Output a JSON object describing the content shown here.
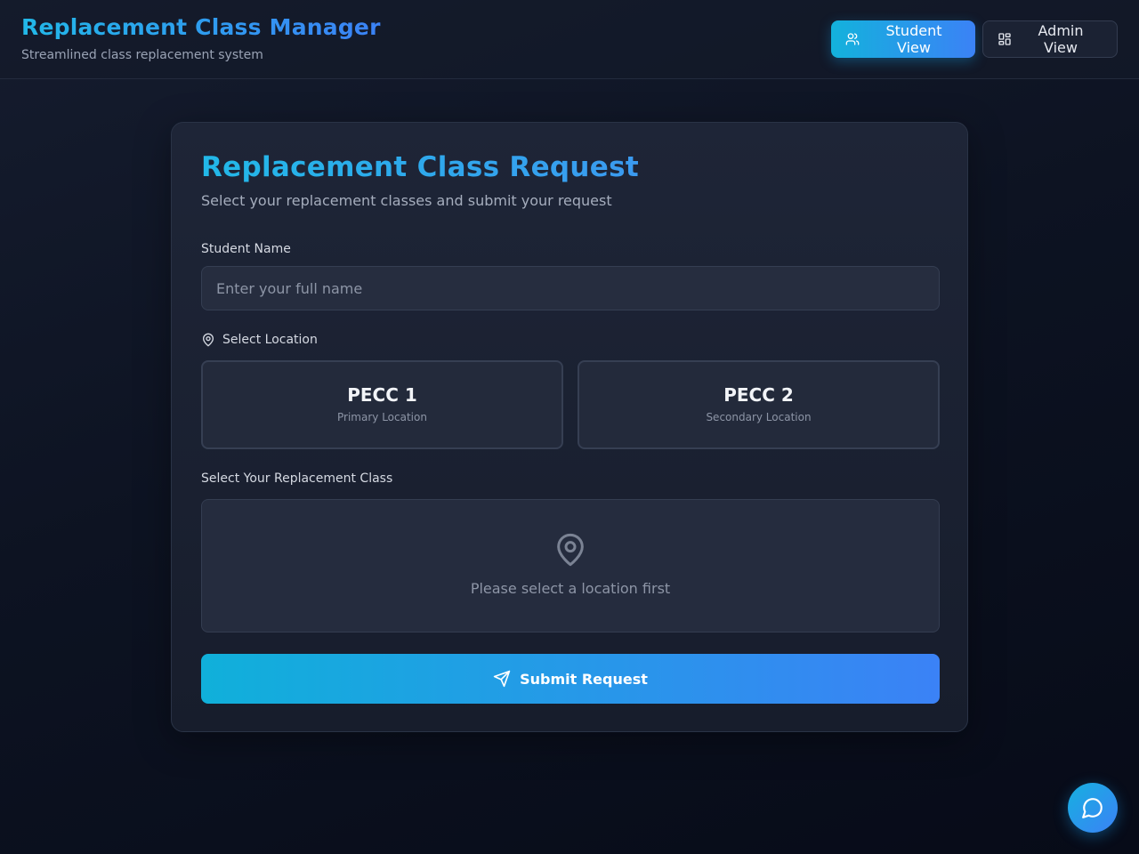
{
  "header": {
    "title": "Replacement Class Manager",
    "subtitle": "Streamlined class replacement system",
    "student_view_label": "Student View",
    "admin_view_label": "Admin View"
  },
  "form": {
    "title": "Replacement Class Request",
    "subtitle": "Select your replacement classes and submit your request",
    "student_name_label": "Student Name",
    "student_name_placeholder": "Enter your full name",
    "student_name_value": "",
    "location_label": "Select Location",
    "locations": [
      {
        "name": "PECC 1",
        "description": "Primary Location"
      },
      {
        "name": "PECC 2",
        "description": "Secondary Location"
      }
    ],
    "class_label": "Select Your Replacement Class",
    "class_empty_message": "Please select a location first",
    "submit_label": "Submit Request"
  },
  "icons": {
    "student_view": "users-icon",
    "admin_view": "dashboard-grid-icon",
    "location": "map-pin-icon",
    "submit": "send-icon",
    "chat": "chat-bubble-icon"
  },
  "colors": {
    "accent_start": "#13b2dc",
    "accent_end": "#3b82f6",
    "background": "#0d1322",
    "card": "#1e2537"
  }
}
